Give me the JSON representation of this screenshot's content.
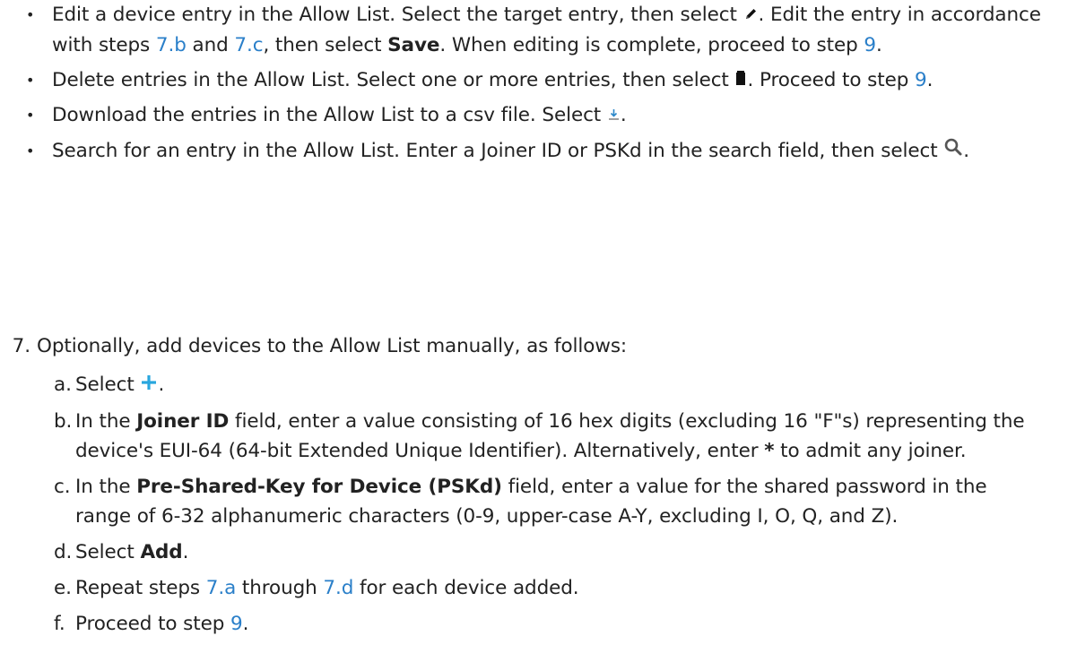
{
  "bullets": [
    {
      "marker": "•",
      "t1": "Edit a device entry in the Allow List. Select the target entry, then select ",
      "icon": "pencil-icon",
      "t2": ". Edit the entry in accordance with steps ",
      "link1": "7.b",
      "t3": " and ",
      "link2": "7.c",
      "t4": ", then select ",
      "bold1": "Save",
      "t5": ". When editing is complete, proceed to step ",
      "link3": "9",
      "t6": "."
    },
    {
      "marker": "•",
      "t1": "Delete entries in the Allow List. Select one or more entries, then select ",
      "icon": "trash-icon",
      "t2": ". Proceed to step ",
      "link1": "9",
      "t3": "."
    },
    {
      "marker": "•",
      "t1": "Download the entries in the Allow List to a csv file. Select ",
      "icon": "download-icon",
      "t2": "."
    },
    {
      "marker": "•",
      "t1": "Search for an entry in the Allow List. Enter a Joiner ID or PSKd in the search field, then select ",
      "icon": "search-icon",
      "t2": "."
    }
  ],
  "step7": {
    "number": "7.",
    "text": "Optionally, add devices to the Allow List manually, as follows:",
    "substeps": [
      {
        "letter": "a.",
        "t1": "Select ",
        "icon": "plus-icon",
        "t2": "."
      },
      {
        "letter": "b.",
        "t1": "In the ",
        "bold1": "Joiner ID",
        "t2": " field, enter a value consisting of 16 hex digits (excluding 16 \"F\"s) representing the device's EUI-64 (64-bit Extended Unique Identifier). Alternatively, enter ",
        "bold2": "*",
        "t3": " to admit any joiner."
      },
      {
        "letter": "c.",
        "t1": "In the ",
        "bold1": "Pre-Shared-Key for Device (PSKd)",
        "t2": " field, enter a value for the shared password in the range of 6-32 alphanumeric characters (0-9, upper-case A-Y, excluding I, O, Q, and Z)."
      },
      {
        "letter": "d.",
        "t1": "Select ",
        "bold1": "Add",
        "t2": "."
      },
      {
        "letter": "e.",
        "t1": "Repeat steps ",
        "link1": "7.a",
        "t2": " through ",
        "link2": "7.d",
        "t3": " for each device added."
      },
      {
        "letter": "f.",
        "t1": "Proceed to step ",
        "link1": "9",
        "t2": "."
      }
    ]
  },
  "colors": {
    "link": "#2a7fc9",
    "plus_icon": "#29a6de",
    "text": "#222222"
  }
}
